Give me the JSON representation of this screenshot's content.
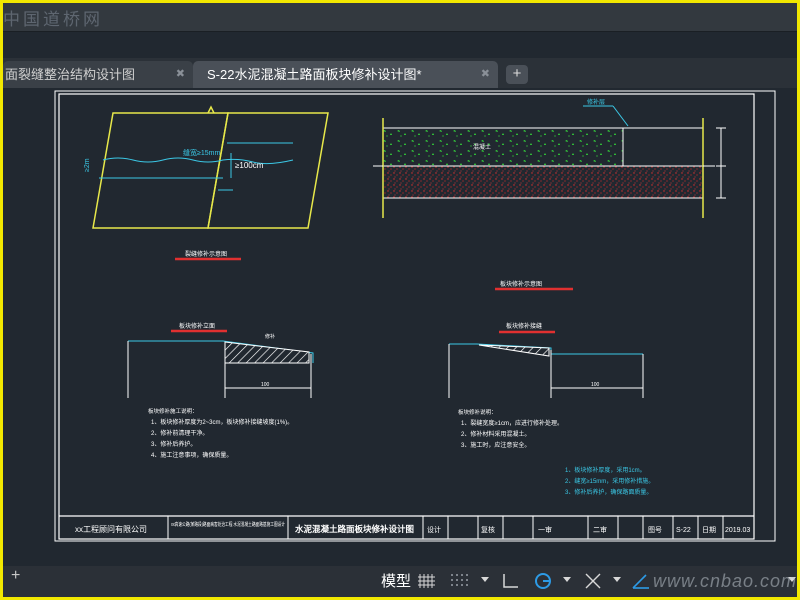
{
  "watermark_top": "中国道桥网",
  "tabs": [
    {
      "label": "面裂缝整治结构设计图",
      "close": "✖"
    },
    {
      "label": "S-22水泥混凝土路面板块修补设计图*",
      "close": "✖"
    }
  ],
  "new_tab": "+",
  "drawing": {
    "title_block": {
      "company": "xx工程顾问有限公司",
      "project": "xx高速公路(某路段)路面病害处治工程 水泥混凝土路面路基施工图设计",
      "drawing_title": "水泥混凝土路面板块修补设计图",
      "design": "设计",
      "review": "复核",
      "check1": "一审",
      "check2": "二审",
      "sheet_no_label": "图号",
      "sheet_no": "S-22",
      "date_label": "日期",
      "date": "2019.03"
    },
    "top_left": {
      "crack_label": "缝宽≥15mm",
      "dim_label": "≥100cm",
      "caption": "裂缝修补示意图"
    },
    "top_right": {
      "caption": "板块修补示意图"
    },
    "bottom_left": {
      "title": "板块修补立面"
    },
    "bottom_right": {
      "title": "板块修补接缝"
    },
    "notes_left": {
      "title": "板块修补施工说明：",
      "lines": [
        "1、板块修补厚度为2~3cm，板块修补接缝坡度(1%)。",
        "2、修补前清理干净。",
        "3、修补后养护。",
        "4、施工注意事项，确保质量。"
      ]
    },
    "notes_right": {
      "title": "板块修补说明：",
      "lines": [
        "1、裂缝宽度≥1cm，应进行修补处理。",
        "2、修补材料采用混凝土。",
        "3、施工时，应注意安全。"
      ]
    },
    "notes_cyan": {
      "lines": [
        "1、板块修补厚度，采用1cm。",
        "2、缝宽≥15mm，采用修补措施。",
        "3、修补后养护，确保路面质量。"
      ]
    }
  },
  "statusbar": {
    "plus": "+",
    "model": "模型",
    "watermark": "www.cnbao.com"
  },
  "colors": {
    "background": "#212830",
    "frame_border": "#f2e800",
    "yellow_lines": "#e7e84a",
    "cyan_lines": "#3bc8e6",
    "green_hatch": "#35e63a",
    "red_hatch": "#e03030"
  }
}
